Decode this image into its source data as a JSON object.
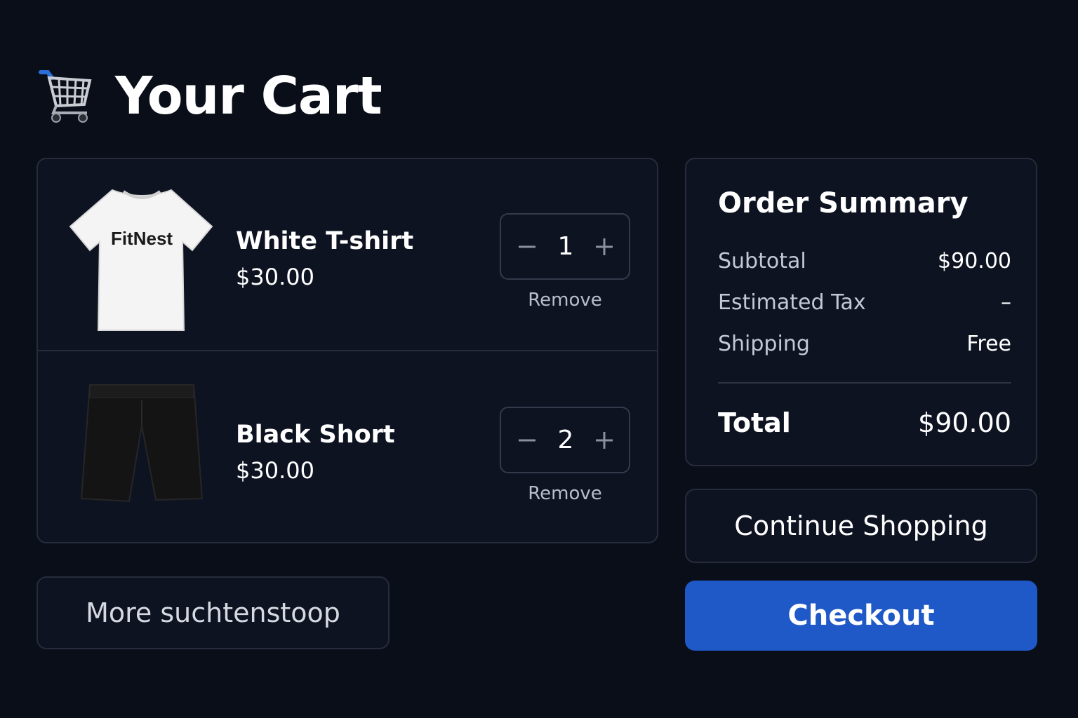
{
  "header": {
    "title": "Your Cart",
    "icon": "shopping-cart-icon"
  },
  "items": [
    {
      "name": "White T-shirt",
      "price": "$30.00",
      "quantity": "1",
      "remove_label": "Remove",
      "image": "white-tshirt-image",
      "shirt_print": "FitNest"
    },
    {
      "name": "Black Short",
      "price": "$30.00",
      "quantity": "2",
      "remove_label": "Remove",
      "image": "black-shorts-image"
    }
  ],
  "summary": {
    "title": "Order Summary",
    "rows": [
      {
        "label": "Subtotal",
        "value": "$90.00"
      },
      {
        "label": "Estimated Tax",
        "value": "–"
      },
      {
        "label": "Shipping",
        "value": "Free"
      }
    ],
    "total_label": "Total",
    "total_value": "$90.00"
  },
  "buttons": {
    "continue_shopping": "Continue Shopping",
    "checkout": "Checkout",
    "more": "More suchtenstoop"
  },
  "colors": {
    "background": "#0a0e19",
    "panel": "#0e1322",
    "border": "#262c3c",
    "accent": "#1f58c7"
  }
}
